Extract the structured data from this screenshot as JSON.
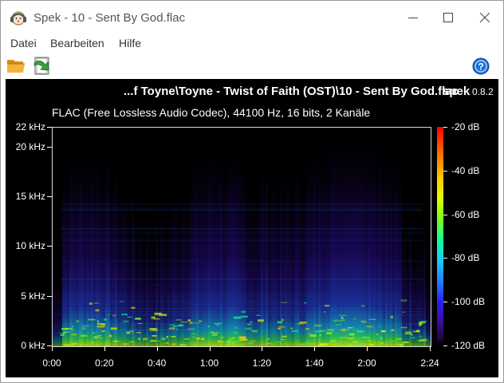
{
  "window": {
    "title": "Spek - 10 - Sent By God.flac"
  },
  "menu": {
    "items": [
      "Datei",
      "Bearbeiten",
      "Hilfe"
    ]
  },
  "toolbar": {
    "buttons": [
      "open-file-icon",
      "save-icon",
      "help-icon"
    ]
  },
  "spek": {
    "file_title": "...f Toyne\\Toyne - Twist of Faith (OST)\\10 - Sent By God.flac",
    "brand": "spek",
    "version": "0.8.2",
    "info": "FLAC (Free Lossless Audio Codec), 44100 Hz, 16 bits, 2 Kanäle"
  },
  "chart_data": {
    "type": "heatmap",
    "x_ticks": [
      "0:00",
      "0:20",
      "0:40",
      "1:00",
      "1:20",
      "1:40",
      "2:00",
      "2:24"
    ],
    "y_ticks": [
      "22 kHz",
      "20 kHz",
      "15 kHz",
      "10 kHz",
      "5 kHz",
      "0 kHz"
    ],
    "colorbar_ticks": [
      "-20 dB",
      "-40 dB",
      "-60 dB",
      "-80 dB",
      "-100 dB",
      "-120 dB"
    ],
    "colors": {
      "background": "#000000",
      "high": "#ff0000",
      "mid_high": "#ffd000",
      "mid": "#13ff9d",
      "mid_low": "#2570ff",
      "low": "#3a0fae"
    }
  }
}
